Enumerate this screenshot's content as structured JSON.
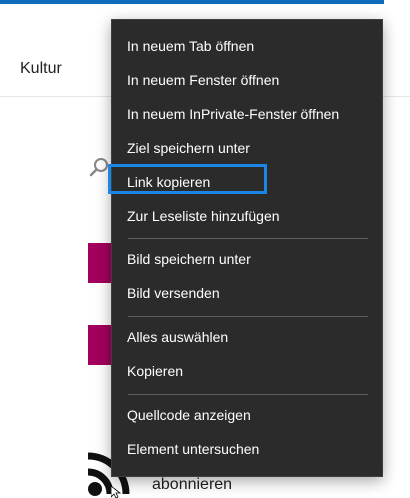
{
  "background": {
    "nav_label": "Kultur",
    "subscribe_label": "abonnieren"
  },
  "context_menu": {
    "items": [
      "In neuem Tab öffnen",
      "In neuem Fenster öffnen",
      "In neuem InPrivate-Fenster öffnen",
      "Ziel speichern unter",
      "Link kopieren",
      "Zur Leseliste hinzufügen",
      "Bild speichern unter",
      "Bild versenden",
      "Alles auswählen",
      "Kopieren",
      "Quellcode anzeigen",
      "Element untersuchen"
    ],
    "focused_item": "Link kopieren"
  },
  "colors": {
    "menu_background": "#2b2b2b",
    "focus_ring": "#1a86e8",
    "accent_bar": "#0f6cbd",
    "tile": "#a2005c"
  },
  "icons": [
    "search-icon",
    "rss-icon",
    "mouse-cursor-icon"
  ]
}
